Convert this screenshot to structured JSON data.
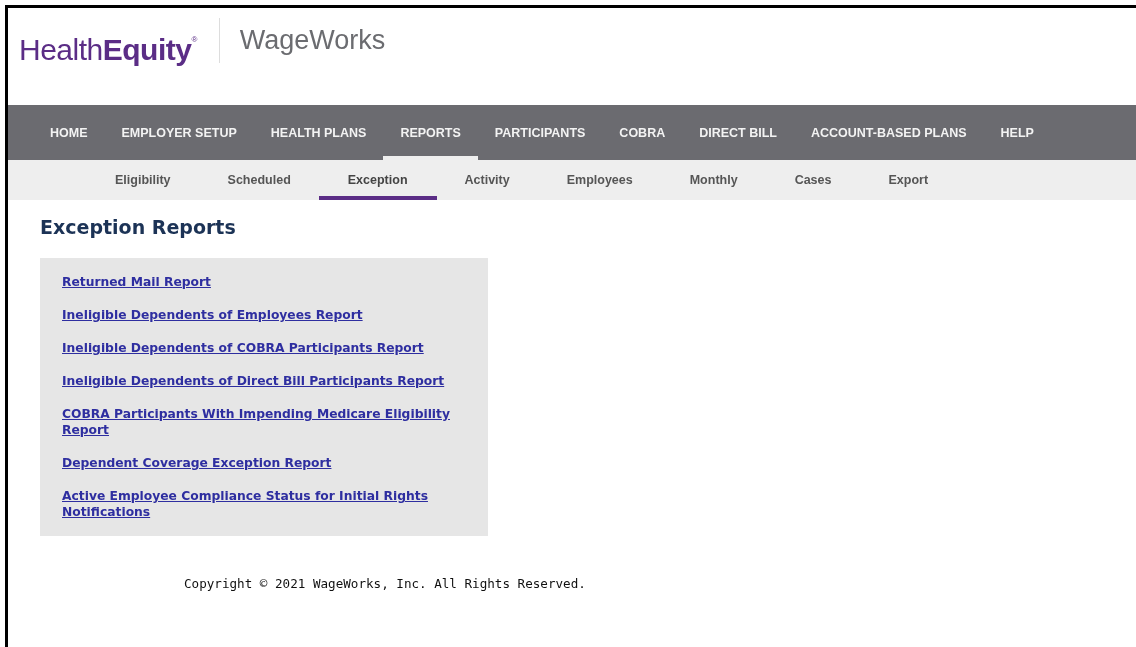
{
  "header": {
    "logo": "Health**Equity**$^{®}$",
    "brand": "WageWorks"
  },
  "main_nav": [
    {
      "label": "HOME",
      "selected": false
    },
    {
      "label": "EMPLOYER SETUP",
      "selected": false
    },
    {
      "label": "HEALTH PLANS",
      "selected": false
    },
    {
      "label": "REPORTS",
      "selected": true
    },
    {
      "label": "PARTICIPANTS",
      "selected": false
    },
    {
      "label": "COBRA",
      "selected": false
    },
    {
      "label": "DIRECT BILL",
      "selected": false
    },
    {
      "label": "ACCOUNT-BASED PLANS",
      "selected": false
    },
    {
      "label": "HELP",
      "selected": false
    }
  ],
  "sub_nav": [
    {
      "label": "Eligibility",
      "selected": false
    },
    {
      "label": "Scheduled",
      "selected": false
    },
    {
      "label": "Exception",
      "selected": true
    },
    {
      "label": "Activity",
      "selected": false
    },
    {
      "label": "Employees",
      "selected": false
    },
    {
      "label": "Monthly",
      "selected": false
    },
    {
      "label": "Cases",
      "selected": false
    },
    {
      "label": "Export",
      "selected": false
    }
  ],
  "page_title": "Exception Reports",
  "report_links": [
    "Returned Mail Report",
    "Ineligible Dependents of Employees Report",
    "Ineligible Dependents of COBRA Participants Report",
    "Ineligible Dependents of Direct Bill Participants Report",
    "COBRA Participants With Impending Medicare Eligibility Report",
    "Dependent Coverage Exception Report",
    "Active Employee Compliance Status for Initial Rights Notifications"
  ],
  "footer": {
    "copyright": "Copyright © 2021 WageWorks, Inc. All Rights Reserved."
  }
}
